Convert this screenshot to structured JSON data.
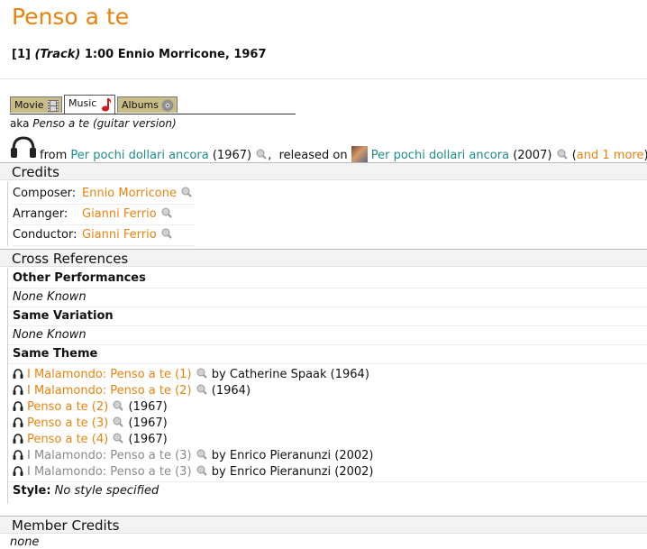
{
  "header": {
    "title": "Penso a te",
    "track_num": "[1]",
    "track_kind": "(Track)",
    "track_rest": "1:00 Ennio Morricone, 1967"
  },
  "tabs": [
    {
      "label": "Movie"
    },
    {
      "label": "Music"
    },
    {
      "label": "Albums"
    }
  ],
  "aka": {
    "prefix": "aka",
    "title": "Penso a te (guitar version)"
  },
  "source": {
    "from_label": "from",
    "from_title": "Per pochi dollari ancora",
    "from_year": "(1967)",
    "comma": ",",
    "released_label": "released on",
    "album_title": "Per pochi dollari ancora",
    "album_year": "(2007)",
    "open_paren": "(",
    "more_link": "and 1 more",
    "close_paren": ")"
  },
  "credits": {
    "heading": "Credits",
    "rows": [
      {
        "role": "Composer:",
        "name": "Ennio Morricone"
      },
      {
        "role": "Arranger:",
        "name": "Gianni Ferrio"
      },
      {
        "role": "Conductor:",
        "name": "Gianni Ferrio"
      }
    ]
  },
  "cross_refs": {
    "heading": "Cross References",
    "other_performances": {
      "label": "Other Performances",
      "value": "None Known"
    },
    "same_variation": {
      "label": "Same Variation",
      "value": "None Known"
    },
    "same_theme": {
      "label": "Same Theme",
      "items": [
        {
          "title": "I Malamondo: Penso a te (1)",
          "suffix": "by Catherine Spaak (1964)",
          "style": "orange"
        },
        {
          "title": "I Malamondo: Penso a te (2)",
          "suffix": "(1964)",
          "style": "orange"
        },
        {
          "title": "Penso a te (2)",
          "suffix": "(1967)",
          "style": "orange"
        },
        {
          "title": "Penso a te (3)",
          "suffix": "(1967)",
          "style": "orange"
        },
        {
          "title": "Penso a te (4)",
          "suffix": "(1967)",
          "style": "orange"
        },
        {
          "title": "I Malamondo: Penso a te (3)",
          "suffix": "by Enrico Pieranunzi (2002)",
          "style": "gray"
        },
        {
          "title": "I Malamondo: Penso a te (3)",
          "suffix": "by Enrico Pieranunzi (2002)",
          "style": "gray"
        }
      ]
    },
    "style": {
      "label": "Style:",
      "value": "No style specified"
    }
  },
  "member_credits": {
    "heading": "Member Credits",
    "value": "none"
  },
  "colors": {
    "accent_orange": "#e8830f",
    "link_teal": "#1f8a8a",
    "tab_tan": "#c8bd87"
  },
  "icons": {
    "zoom": "magnifier-icon",
    "headphones": "headphones-icon",
    "film": "film-strip-icon",
    "note": "music-note-icon",
    "disc": "disc-icon"
  }
}
